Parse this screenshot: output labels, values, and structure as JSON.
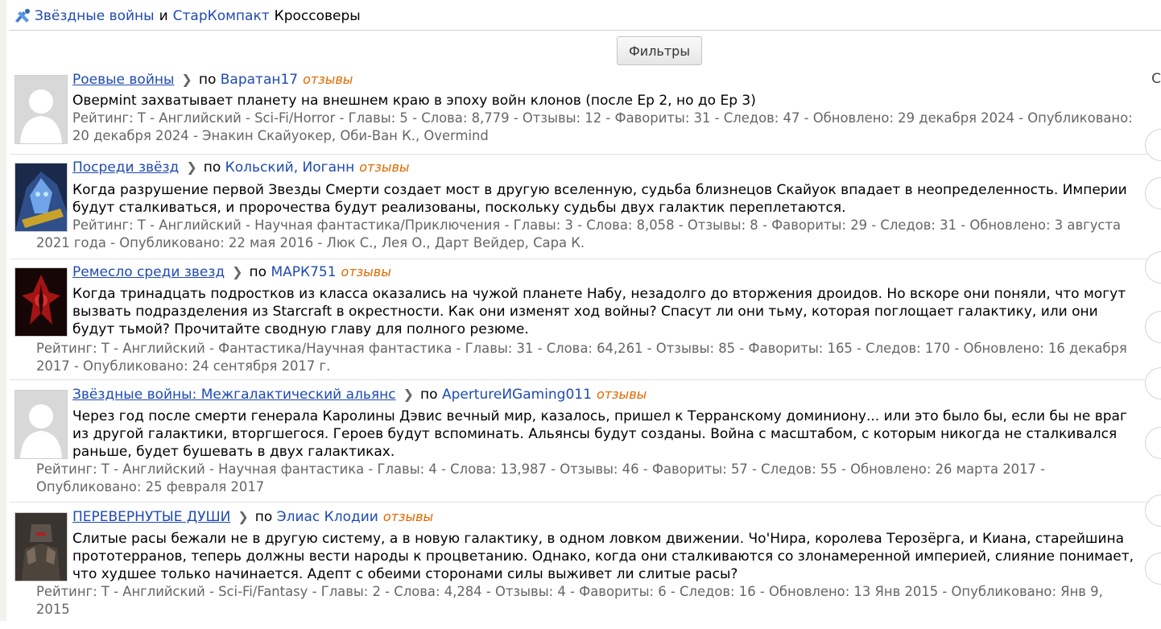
{
  "breadcrumb": {
    "part1": "Звёздные войны",
    "and": "и",
    "part2": "СтарКомпакт",
    "part3": "Кроссоверы",
    "icon": "crossover-icon"
  },
  "filters_label": "Фильтры",
  "right_edge_char": "С",
  "stories": [
    {
      "title": "Роевые войны",
      "by": "по",
      "author": "Варатан17",
      "reviews": "отзывы",
      "summary": "Овермint захватывает планету на внешнем краю в эпоху войн клонов (после Ep 2, но до Ep 3)",
      "meta": "Рейтинг: T - Английский - Sci-Fi/Horror - Главы: 5 - Слова: 8,779 - Отзывы: 12 - Фавориты: 31 - Следов: 47 - Обновлено: 29 декабря 2024 - Опубликовано: 20 декабря 2024 - Энакин Скайуокер, Оби-Ван К., Overmind",
      "thumb": "default-avatar"
    },
    {
      "title": "Посреди звёзд",
      "by": "по",
      "author": "Кольский, Иоганн",
      "reviews": "отзывы",
      "summary": "Когда разрушение первой Звезды Смерти создает мост в другую вселенную, судьба близнецов Скайуок впадает в неопределенность. Империи будут сталкиваться, и пророчества будут реализованы, поскольку судьбы двух галактик переплетаются.",
      "meta": "Рейтинг: T - Английский - Научная фантастика/Приключения - Главы: 3 - Слова: 8,058 - Отзывы: 8 - Фавориты: 29 - Следов: 31 - Обновлено: 3 августа 2021 года - Опубликовано: 22 мая 2016 - Люк С., Лея О., Дарт Вейдер, Сара К.",
      "thumb": "protoss-image"
    },
    {
      "title": "Ремесло среди звезд",
      "by": "по",
      "author": "МАРК751",
      "reviews": "отзывы",
      "summary": "Когда тринадцать подростков из класса оказались на чужой планете Набу, незадолго до вторжения дроидов. Но вскоре они поняли, что могут вызвать подразделения из Starcraft в окрестности. Как они изменят ход войны? Спасут ли они тьму, которая поглощает галактику, или они будут тьмой? Прочитайте сводную главу для полного резюме.",
      "meta": "Рейтинг: T - Английский - Фантастика/Научная фантастика - Главы: 31 - Слова: 64,261 - Отзывы: 85 - Фавориты: 165 - Следов: 170 - Обновлено: 16 декабря 2017 - Опубликовано: 24 сентября 2017 г.",
      "thumb": "red-emblem-image"
    },
    {
      "title": "Звёздные войны: Межгалактический альянс",
      "by": "по",
      "author": "ApertureИGaming011",
      "reviews": "отзывы",
      "summary": "Через год после смерти генерала Каролины Дэвис вечный мир, казалось, пришел к Терранскому доминиону... или это было бы, если бы не враг из другой галактики, вторгшегося. Героев будут вспоминать. Альянсы будут созданы. Война с масштабом, с которым никогда не сталкивался раньше, будет бушевать в двух галактиках.",
      "meta": "Рейтинг: T - Английский - Научная фантастика - Главы: 4 - Слова: 13,987 - Отзывы: 46 - Фавориты: 57 - Следов: 55 - Обновлено: 26 марта 2017 - Опубликовано: 25 февраля 2017",
      "thumb": "default-avatar"
    },
    {
      "title": "ПЕРЕВЕРНУТЫЕ ДУШИ",
      "by": "по",
      "author": "Элиас Клодии",
      "reviews": "отзывы",
      "summary": "Слитые расы бежали не в другую систему, а в новую галактику, в одном ловком движении. Чо'Нира, королева Терозёрга, и Киана, старейшина прототерранов, теперь должны вести народы к процветанию. Однако, когда они сталкиваются со злонамеренной империей, слияние понимает, что худшее только начинается. Адепт с обеими сторонами силы выживет ли слитые расы?",
      "meta": "Рейтинг: T - Английский - Sci-Fi/Fantasy - Главы: 2 - Слова: 4,284 - Отзывы: 4 - Фавориты: 6 - Следов: 16 - Обновлено: 13 Янв 2015 - Опубликовано: Янв 9, 2015",
      "thumb": "armored-warrior-image"
    }
  ]
}
